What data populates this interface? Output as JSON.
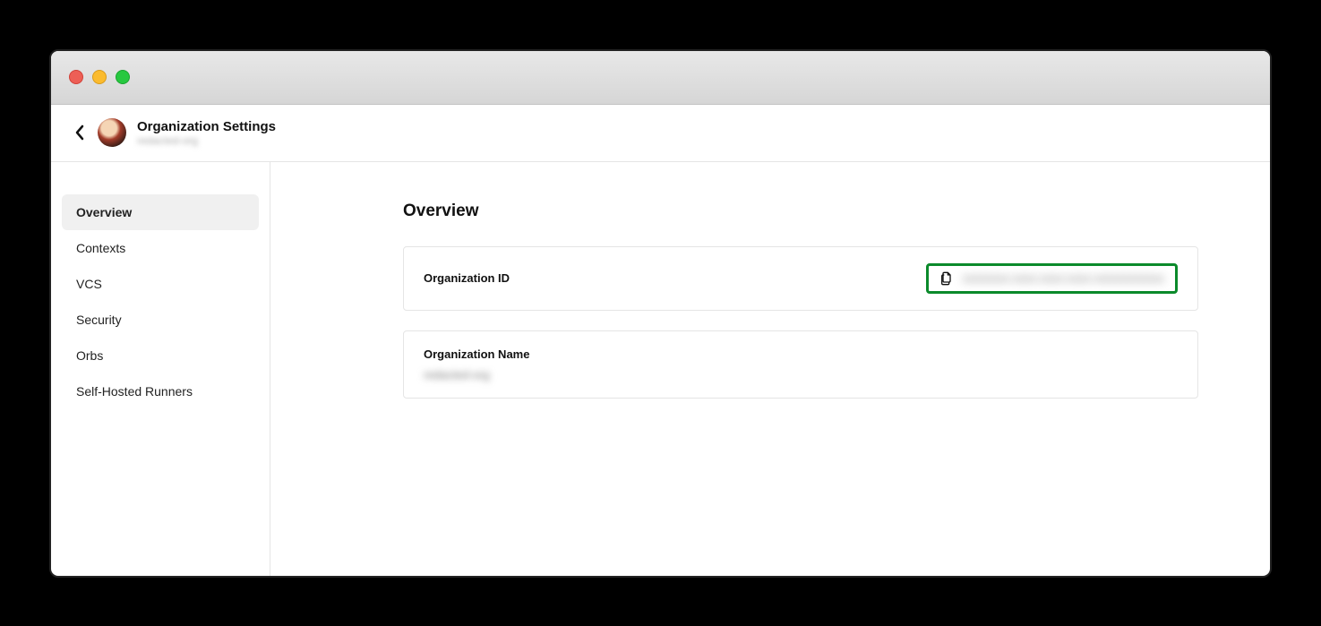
{
  "header": {
    "title": "Organization Settings",
    "subtitle": "redacted-org"
  },
  "sidebar": {
    "items": [
      {
        "label": "Overview",
        "active": true
      },
      {
        "label": "Contexts",
        "active": false
      },
      {
        "label": "VCS",
        "active": false
      },
      {
        "label": "Security",
        "active": false
      },
      {
        "label": "Orbs",
        "active": false
      },
      {
        "label": "Self-Hosted Runners",
        "active": false
      }
    ]
  },
  "main": {
    "section_title": "Overview",
    "org_id_label": "Organization ID",
    "org_id_value": "xxxxxxxx-xxxx-xxxx-xxxx-xxxxxxxxxxxx",
    "org_name_label": "Organization Name",
    "org_name_value": "redacted-org"
  }
}
